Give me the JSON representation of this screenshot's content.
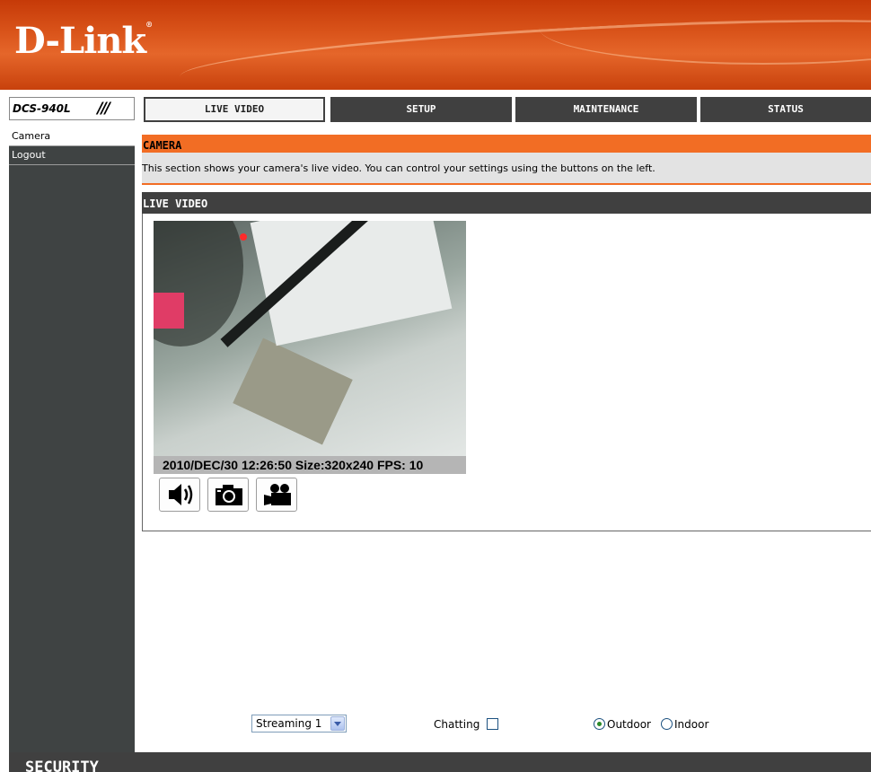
{
  "brand": {
    "logo": "D-Link",
    "mark": "®"
  },
  "model": {
    "name": "DCS-940L",
    "slashes": "///"
  },
  "tabs": [
    {
      "label": "LIVE VIDEO",
      "active": true
    },
    {
      "label": "SETUP",
      "active": false
    },
    {
      "label": "MAINTENANCE",
      "active": false
    },
    {
      "label": "STATUS",
      "active": false
    }
  ],
  "sidebar": {
    "items": [
      {
        "label": "Camera",
        "active": true
      },
      {
        "label": "Logout",
        "active": false
      }
    ]
  },
  "camera_section": {
    "title": "CAMERA",
    "description": "This section shows your camera's live video. You can control your settings using the buttons on the left."
  },
  "live_video": {
    "title": "LIVE VIDEO",
    "overlay": "2010/DEC/30 12:26:50 Size:320x240 FPS: 10",
    "buttons": [
      {
        "icon": "speaker-icon"
      },
      {
        "icon": "camera-icon"
      },
      {
        "icon": "video-camera-icon"
      }
    ]
  },
  "controls": {
    "stream_select": {
      "value": "Streaming 1"
    },
    "chatting_label": "Chatting",
    "chatting_checked": false,
    "environment": [
      {
        "label": "Outdoor",
        "selected": true
      },
      {
        "label": "Indoor",
        "selected": false
      }
    ]
  },
  "footer": {
    "label": "SECURITY"
  },
  "colors": {
    "orange": "#f26d24",
    "dark": "#404040",
    "header": "#d9531a"
  }
}
